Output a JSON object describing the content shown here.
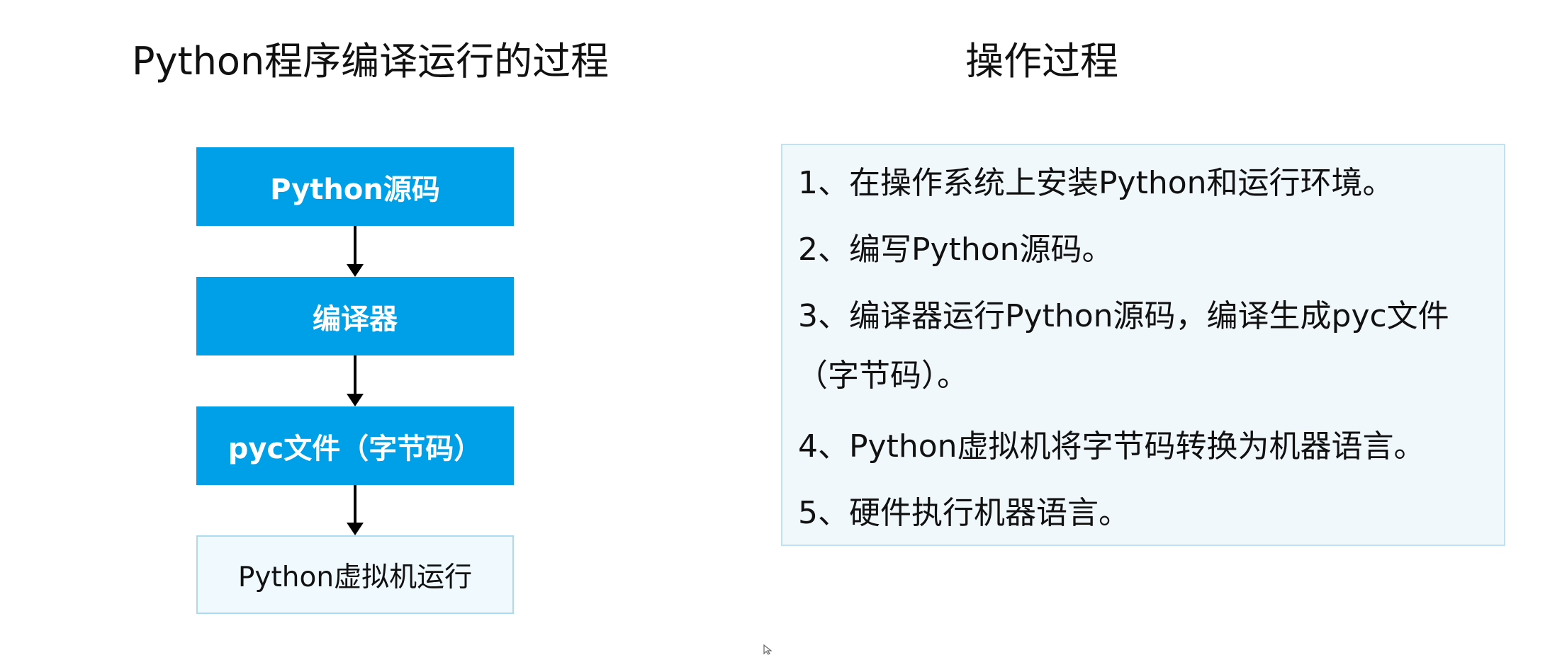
{
  "left_title": "Python程序编译运行的过程",
  "right_title": "操作过程",
  "flow": {
    "boxes": [
      "Python源码",
      "编译器",
      "pyc文件（字节码）",
      "Python虚拟机运行"
    ]
  },
  "steps": {
    "items": [
      "1、在操作系统上安装Python和运行环境。",
      "2、编写Python源码。",
      "3、编译器运行Python源码，编译生成pyc文件",
      "（字节码）。",
      "4、Python虚拟机将字节码转换为机器语言。",
      "5、硬件执行机器语言。"
    ]
  },
  "colors": {
    "box_fill": "#00a0e9",
    "box_outline": "#a9dcef",
    "panel_fill": "#f0f8fc",
    "panel_border": "#bfe3f2"
  },
  "icons": {
    "cursor": "mouse-pointer-icon"
  }
}
